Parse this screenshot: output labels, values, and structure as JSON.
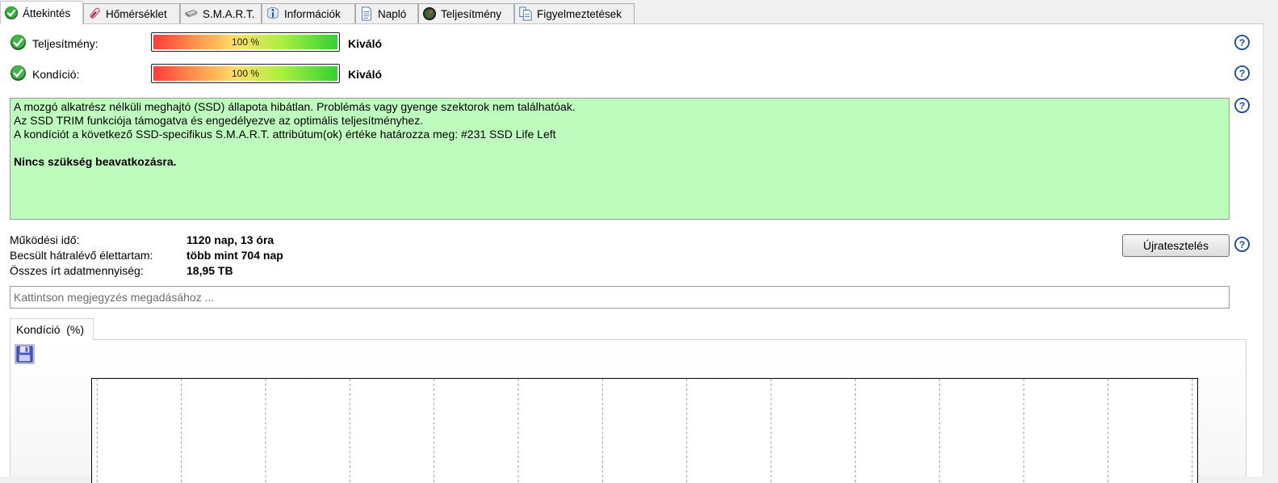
{
  "tabs": [
    {
      "label": "Áttekintés",
      "icon": "check-circle-icon",
      "active": true
    },
    {
      "label": "Hőmérséklet",
      "icon": "thermometer-icon",
      "active": false
    },
    {
      "label": "S.M.A.R.T.",
      "icon": "drive-icon",
      "active": false
    },
    {
      "label": "Információk",
      "icon": "info-icon",
      "active": false
    },
    {
      "label": "Napló",
      "icon": "log-document-icon",
      "active": false
    },
    {
      "label": "Teljesítmény",
      "icon": "speedometer-icon",
      "active": false
    },
    {
      "label": "Figyelmeztetések",
      "icon": "alerts-document-icon",
      "active": false
    }
  ],
  "performance": {
    "label": "Teljesítmény:",
    "percent_text": "100 %",
    "percent": 100,
    "rating": "Kiváló"
  },
  "health": {
    "label": "Kondíció:",
    "percent_text": "100 %",
    "percent": 100,
    "rating": "Kiváló"
  },
  "message": {
    "lines": [
      "A mozgó alkatrész nélküli meghajtó (SSD) állapota hibátlan. Problémás vagy gyenge szektorok nem találhatóak.",
      "Az SSD TRIM funkciója támogatva és engedélyezve az optimális teljesítményhez.",
      "A kondíciót a következő SSD-specifikus S.M.A.R.T. attribútum(ok) értéke határozza meg:  #231 SSD Life Left"
    ],
    "action": "Nincs szükség beavatkozásra.",
    "background": "#bdfcbd"
  },
  "stats": {
    "uptime_label": "Működési idő:",
    "uptime_value": "1120 nap, 13 óra",
    "lifetime_label": "Becsült hátralévő élettartam:",
    "lifetime_value": "több mint 704 nap",
    "written_label": "Összes írt adatmennyiség:",
    "written_value": "18,95 TB"
  },
  "retest_label": "Újratesztelés",
  "note_placeholder": "Kattintson megjegyzés megadásához ...",
  "chart_tab_label": "Kondíció  (%)",
  "chart_data": {
    "type": "line",
    "series": [],
    "vertical_gridlines": 14,
    "grid_style": "dashed"
  }
}
